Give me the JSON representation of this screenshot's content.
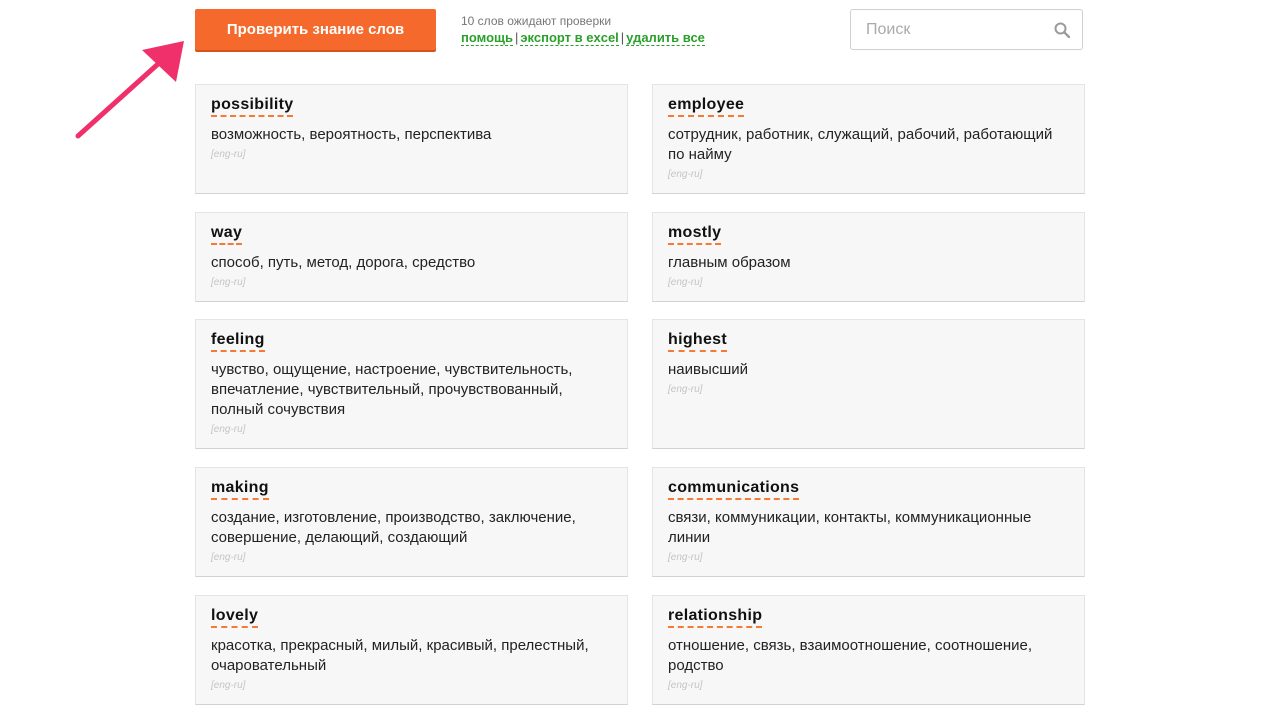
{
  "toolbar": {
    "check_button": "Проверить знание слов",
    "pending_text": "10 слов ожидают проверки",
    "links": {
      "help": "помощь",
      "export": "экспорт в excel",
      "delete_all": "удалить все",
      "separator": "|"
    }
  },
  "search": {
    "placeholder": "Поиск",
    "value": ""
  },
  "colors": {
    "accent": "#f56a2c",
    "link": "#2aa02a",
    "pointer_arrow": "#f0306a"
  },
  "cards": [
    {
      "word": "possibility",
      "translation": "возможность, вероятность, перспектива",
      "lang": "[eng-ru]"
    },
    {
      "word": "employee",
      "translation": "сотрудник, работник, служащий, рабочий, работающий по найму",
      "lang": "[eng-ru]"
    },
    {
      "word": "way",
      "translation": "способ, путь, метод, дорога, средство",
      "lang": "[eng-ru]"
    },
    {
      "word": "mostly",
      "translation": "главным образом",
      "lang": "[eng-ru]"
    },
    {
      "word": "feeling",
      "translation": "чувство, ощущение, настроение, чувствительность, впечатление, чувствительный, прочувствованный, полный сочувствия",
      "lang": "[eng-ru]"
    },
    {
      "word": "highest",
      "translation": "наивысший",
      "lang": "[eng-ru]"
    },
    {
      "word": "making",
      "translation": "создание, изготовление, производство, заключение, совершение, делающий, создающий",
      "lang": "[eng-ru]"
    },
    {
      "word": "communications",
      "translation": "связи, коммуникации, контакты, коммуникационные линии",
      "lang": "[eng-ru]"
    },
    {
      "word": "lovely",
      "translation": "красотка, прекрасный, милый, красивый, прелестный, очаровательный",
      "lang": "[eng-ru]"
    },
    {
      "word": "relationship",
      "translation": "отношение, связь, взаимоотношение, соотношение, родство",
      "lang": "[eng-ru]"
    }
  ]
}
